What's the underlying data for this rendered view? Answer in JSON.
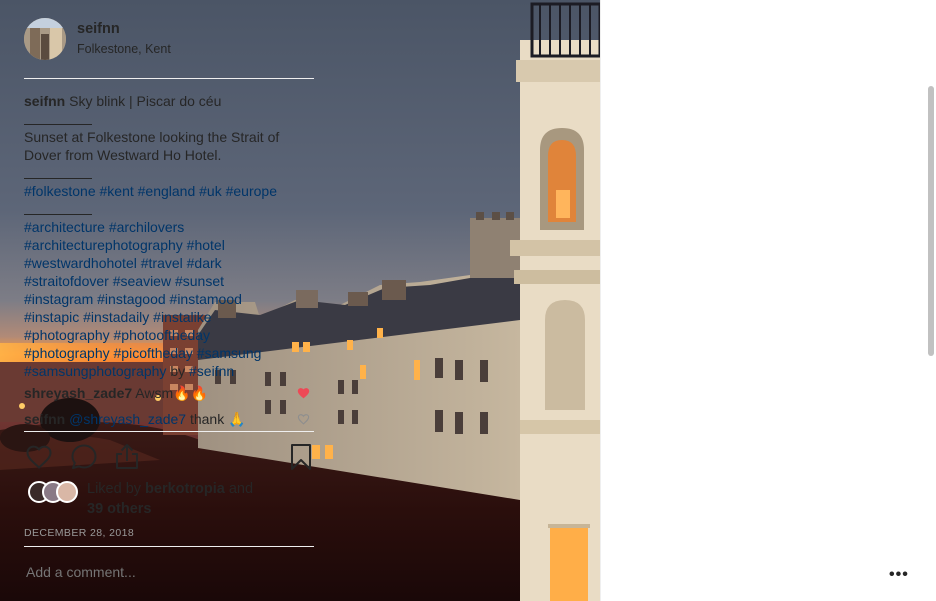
{
  "post": {
    "author": "seifnn",
    "location": "Folkestone, Kent"
  },
  "caption": {
    "author": "seifnn",
    "title": " Sky blink | Piscar do céu",
    "line1": "Sunset at Folkestone looking the Strait of",
    "line2": "Dover from Westward Ho Hotel.",
    "tags1": "#folkestone #kent #england #uk #europe",
    "tags2": [
      "#architecture #archilovers",
      "#architecturephotography #hotel",
      "#westwardhohotel #travel #dark",
      "#straitofdover #seaview #sunset",
      "#instagram #instagood #instamood",
      "#instapic #instadaily #instalike",
      "#photography #photooftheday",
      "#photography #picoftheday #samsung"
    ],
    "last_tag": "#samsungphotography",
    "by_text": " by ",
    "by_mention": "#seifnn"
  },
  "comments": [
    {
      "author": "shreyash_zade7",
      "text": " Awsm🔥🔥",
      "liked": true
    },
    {
      "author": "seifnn",
      "mention": " @shreyash_zade7",
      "text": " thank 🙏",
      "liked": false
    }
  ],
  "actions": {
    "like": "heart-icon",
    "comment": "comment-icon",
    "share": "share-icon",
    "save": "bookmark-icon"
  },
  "likes": {
    "prefix": "Liked by ",
    "user": "berkotropia",
    "and": " and",
    "others": "39 others"
  },
  "date": "DECEMBER 28, 2018",
  "add_comment_placeholder": "Add a comment...",
  "more_label": "•••",
  "colors": {
    "liked_heart": "#ed4956",
    "hashtag": "#003569",
    "muted": "#999999"
  }
}
